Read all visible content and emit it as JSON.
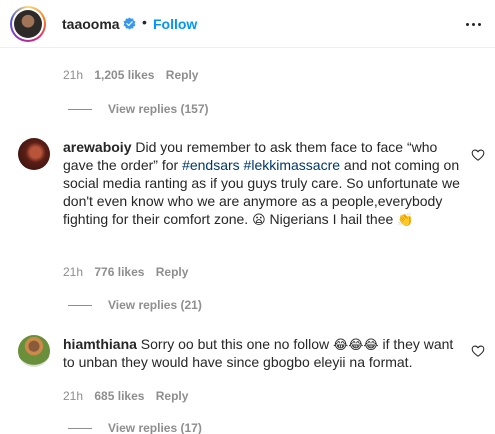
{
  "header": {
    "username": "taaooma",
    "separator": "•",
    "follow_label": "Follow"
  },
  "top_thread": {
    "time": "21h",
    "likes": "1,205 likes",
    "reply_label": "Reply",
    "view_replies": "View replies (157)"
  },
  "comments": [
    {
      "username": "arewaboiy",
      "text_before": "Did you remember to ask them face to face “who gave the order” for ",
      "hashtag1": "#endsars",
      "hashtag2": "#lekkimassacre",
      "text_after": " and not coming on social media ranting as if you guys truly care. So unfortunate we don't even know who we are anymore as a people,everybody fighting for their comfort zone. ",
      "emoji_sad": "😦",
      "text_end": " Nigerians I hail thee ",
      "emoji_clap": "👏",
      "time": "21h",
      "likes": "776 likes",
      "reply_label": "Reply",
      "view_replies": "View replies (21)"
    },
    {
      "username": "hiamthiana",
      "text_before": "Sorry oo but this one no follow ",
      "emoji_laugh": "😂😂😂",
      "text_after": " if they want to unban they would have since gbogbo eleyii na format.",
      "time": "21h",
      "likes": "685 likes",
      "reply_label": "Reply",
      "view_replies": "View replies (17)"
    }
  ],
  "colors": {
    "accent": "#0095f6",
    "hashtag": "#00376b",
    "muted": "#8e8e8e",
    "text": "#262626"
  }
}
